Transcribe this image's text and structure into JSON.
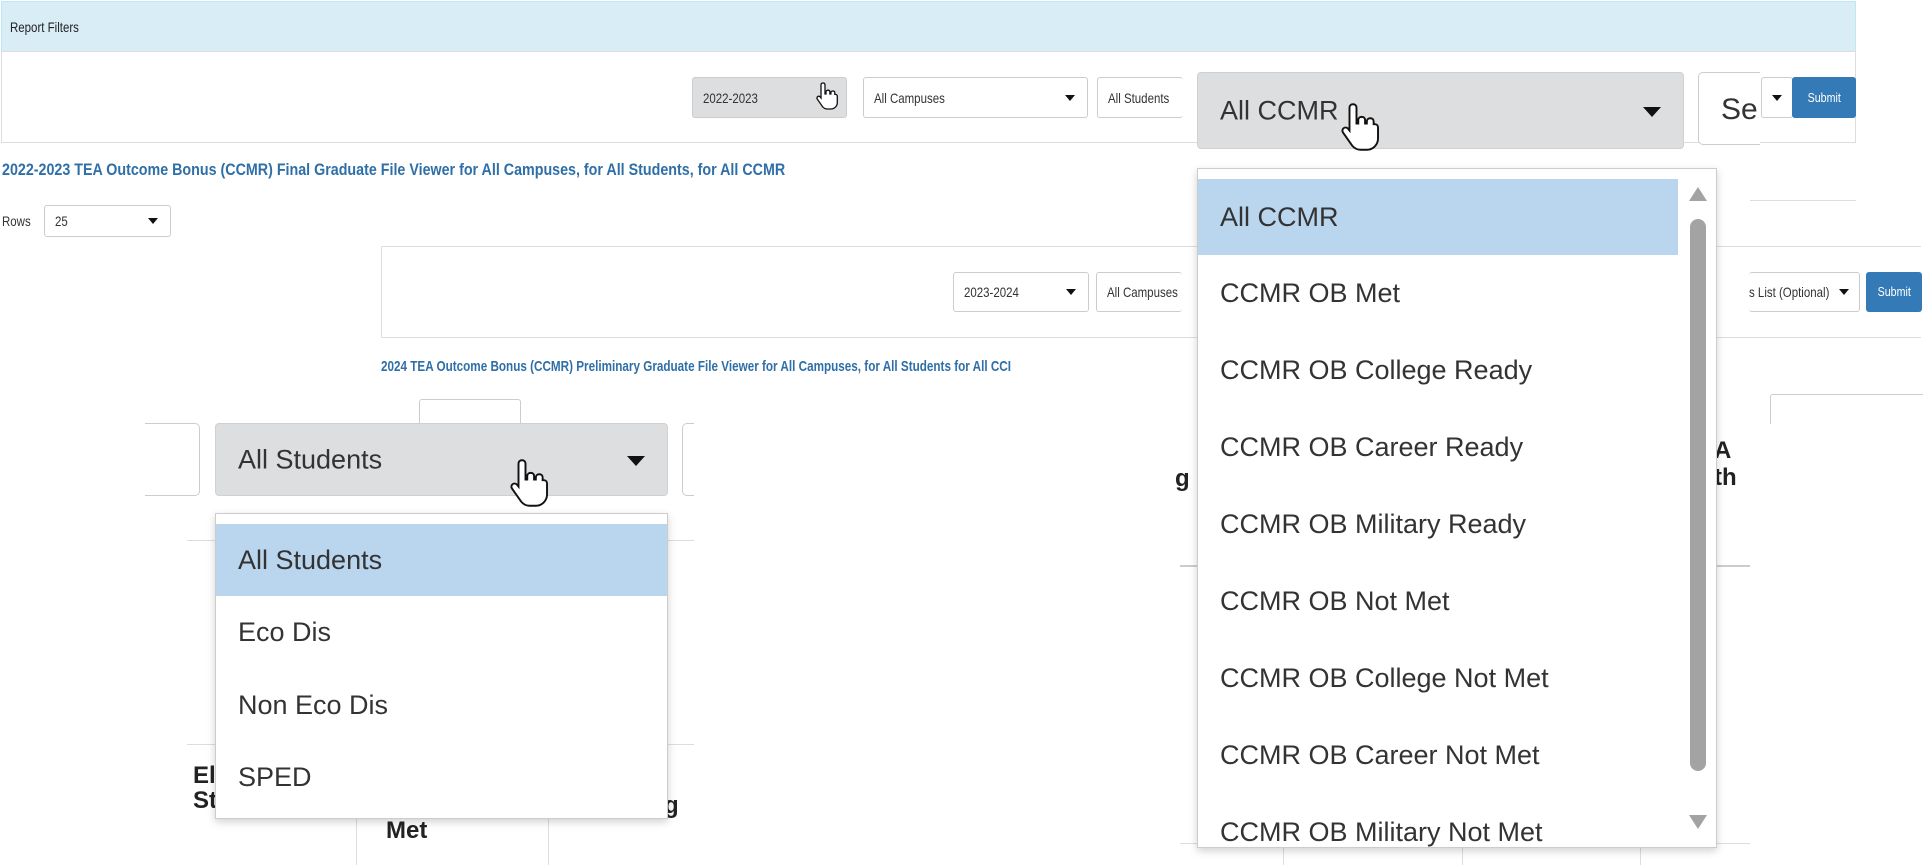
{
  "report_filters": {
    "header": "Report Filters",
    "year_select": "2022-2023",
    "campus_select": "All Campuses",
    "students_select_cut": "All Students",
    "search_cut": "Se",
    "submit_label": "Submit"
  },
  "report_title_2022": "2022-2023 TEA Outcome Bonus (CCMR) Final Graduate File Viewer for All Campuses, for All Students, for All CCMR",
  "rows": {
    "label": "Rows",
    "value": "25"
  },
  "second_panel": {
    "year_select": "2023-2024",
    "campus_select": "All Campuses",
    "list_select_cut": "s List (Optional)",
    "submit_label": "Submit",
    "title": "2024 TEA Outcome Bonus (CCMR) Preliminary Graduate File Viewer for All Campuses, for All Students for All CCI"
  },
  "students_dropdown": {
    "selected": "All Students",
    "options": [
      "All Students",
      "Eco Dis",
      "Non Eco Dis",
      "SPED"
    ]
  },
  "ccmr_dropdown": {
    "selected": "All CCMR",
    "options": [
      "All CCMR",
      "CCMR OB Met",
      "CCMR OB College Ready",
      "CCMR OB Career Ready",
      "CCMR OB Military Ready",
      "CCMR OB Not Met",
      "CCMR OB College Not Met",
      "CCMR OB Career Not Met",
      "CCMR OB Military Not Met"
    ]
  },
  "table_fragments": {
    "col_a_line1": "El",
    "col_a_line2": "St",
    "col_b": "Met",
    "col_c": "g",
    "col_d": "g",
    "col_e_line1": "A",
    "col_e_line2": "th"
  },
  "icons": [
    "hand-pointer-icon",
    "caret-down-icon",
    "scroll-up-arrow-icon",
    "scroll-down-arrow-icon"
  ]
}
